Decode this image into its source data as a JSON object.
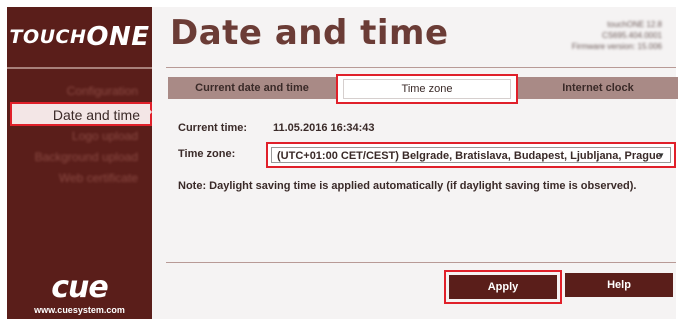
{
  "brand": {
    "logo_part1": "TOUCH",
    "logo_part2": "ONE",
    "cue_logo": "cue",
    "cue_url": "www.cuesystem.com"
  },
  "sidebar": {
    "items": [
      {
        "label": "Configuration",
        "active": false
      },
      {
        "label": "Date and time",
        "active": true
      },
      {
        "label": "Logo upload",
        "active": false
      },
      {
        "label": "Background upload",
        "active": false
      },
      {
        "label": "Web certificate",
        "active": false
      }
    ]
  },
  "header": {
    "title": "Date and time",
    "version_lines": [
      "touchONE 12.8",
      "CS695.404.0001",
      "Firmware version: 15.006"
    ]
  },
  "tabs": [
    {
      "label": "Current date and time",
      "active": false
    },
    {
      "label": "Time zone",
      "active": true
    },
    {
      "label": "Internet clock",
      "active": false
    }
  ],
  "form": {
    "current_time_label": "Current time:",
    "current_time_value": "11.05.2016   16:34:43",
    "time_zone_label": "Time zone:",
    "time_zone_value": "(UTC+01:00 CET/CEST) Belgrade, Bratislava, Budapest, Ljubljana, Prague",
    "note": "Note: Daylight saving time is applied automatically (if daylight saving time is observed)."
  },
  "buttons": {
    "apply": "Apply",
    "help": "Help"
  },
  "colors": {
    "brand_dark": "#5a1e1a",
    "tab_inactive": "#a98a86",
    "title_color": "#6b3c36",
    "highlight_red": "#e0202a"
  }
}
